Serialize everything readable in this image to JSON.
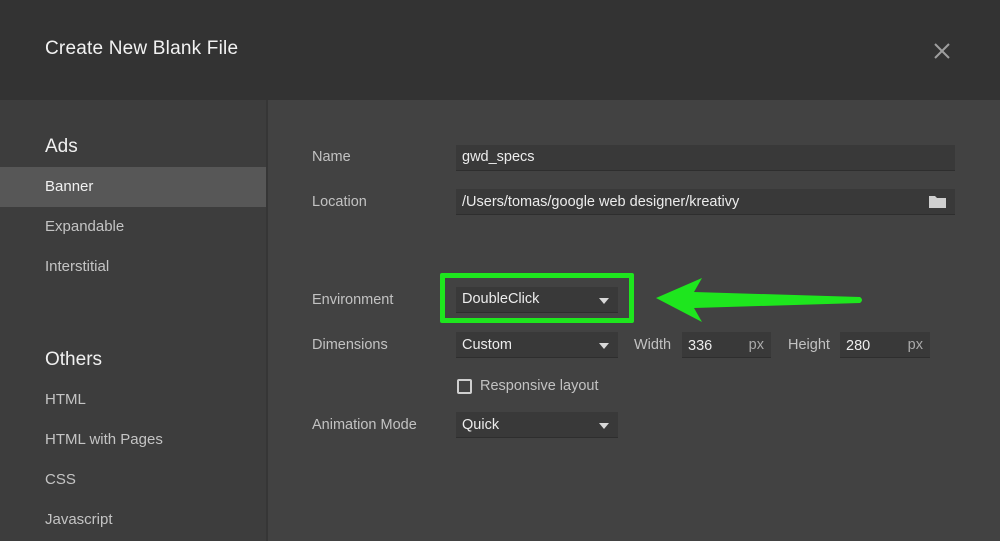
{
  "dialog": {
    "title": "Create New Blank File"
  },
  "sidebar": {
    "sections": [
      {
        "heading": "Ads",
        "items": [
          "Banner",
          "Expandable",
          "Interstitial"
        ]
      },
      {
        "heading": "Others",
        "items": [
          "HTML",
          "HTML with Pages",
          "CSS",
          "Javascript"
        ]
      }
    ],
    "selected": "Banner"
  },
  "form": {
    "name": {
      "label": "Name",
      "value": "gwd_specs"
    },
    "location": {
      "label": "Location",
      "value": "/Users/tomas/google web designer/kreativy"
    },
    "environment": {
      "label": "Environment",
      "value": "DoubleClick"
    },
    "dimensions": {
      "label": "Dimensions",
      "preset": "Custom",
      "width_label": "Width",
      "width": "336",
      "height_label": "Height",
      "height": "280",
      "unit": "px"
    },
    "responsive": {
      "label": "Responsive layout",
      "checked": false
    },
    "animation": {
      "label": "Animation Mode",
      "value": "Quick"
    }
  },
  "icons": {
    "close": "close-icon",
    "folder": "folder-icon",
    "dropdown": "chevron-down-icon",
    "annotation": "arrow-icon"
  },
  "colors": {
    "highlight": "#1ee61e",
    "header": "#333333",
    "body": "#424242"
  }
}
